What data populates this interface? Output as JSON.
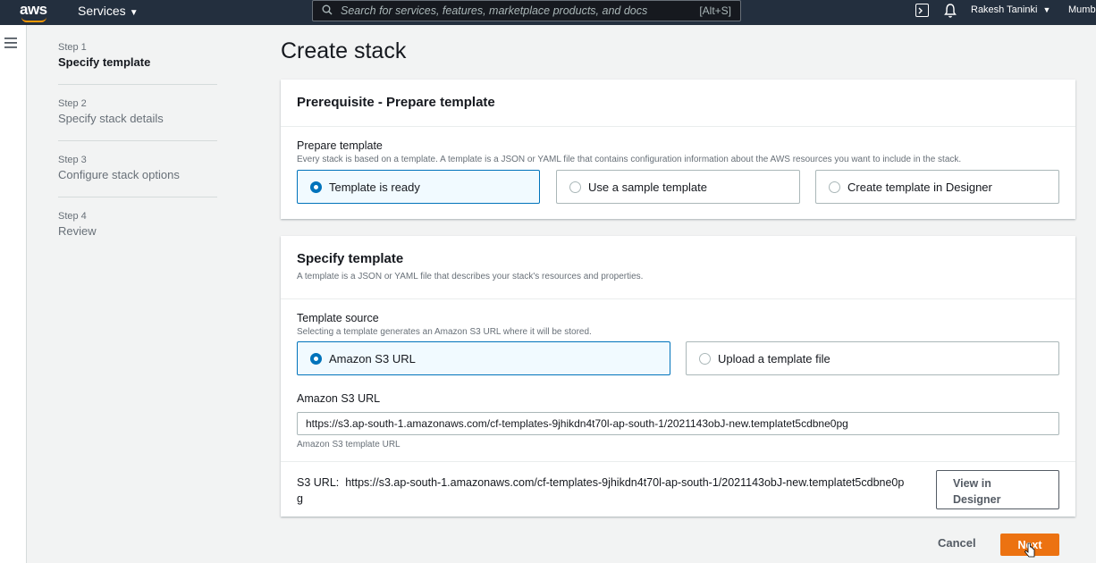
{
  "nav": {
    "logo": "aws",
    "services": "Services",
    "search_placeholder": "Search for services, features, marketplace products, and docs",
    "search_shortcut": "[Alt+S]",
    "user": "Rakesh Taninki",
    "region": "Mumb"
  },
  "steps": [
    {
      "num": "Step 1",
      "name": "Specify template"
    },
    {
      "num": "Step 2",
      "name": "Specify stack details"
    },
    {
      "num": "Step 3",
      "name": "Configure stack options"
    },
    {
      "num": "Step 4",
      "name": "Review"
    }
  ],
  "page_title": "Create stack",
  "prerequisite": {
    "title": "Prerequisite - Prepare template",
    "label": "Prepare template",
    "desc": "Every stack is based on a template. A template is a JSON or YAML file that contains configuration information about the AWS resources you want to include in the stack.",
    "options": [
      "Template is ready",
      "Use a sample template",
      "Create template in Designer"
    ]
  },
  "specify": {
    "title": "Specify template",
    "desc": "A template is a JSON or YAML file that describes your stack's resources and properties.",
    "source_label": "Template source",
    "source_desc": "Selecting a template generates an Amazon S3 URL where it will be stored.",
    "source_options": [
      "Amazon S3 URL",
      "Upload a template file"
    ],
    "url_label": "Amazon S3 URL",
    "url_value": "https://s3.ap-south-1.amazonaws.com/cf-templates-9jhikdn4t70l-ap-south-1/2021143obJ-new.templatet5cdbne0pg",
    "url_hint": "Amazon S3 template URL",
    "s3_prefix": "S3 URL:",
    "s3_line1": "https://s3.ap-south-1.amazonaws.com/cf-templates-9jhikdn4t70l-ap-south-1/2021143obJ-new.templatet5cdbne0p",
    "s3_line2": "g",
    "view_line1": "View in",
    "view_line2": "Designer"
  },
  "footer": {
    "cancel": "Cancel",
    "next": "Next"
  },
  "colors": {
    "accent": "#0073bb",
    "primary": "#ec7211",
    "nav_bg": "#232f3e"
  }
}
